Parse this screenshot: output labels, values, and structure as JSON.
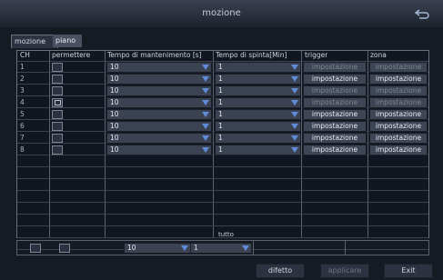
{
  "window": {
    "title": "mozione"
  },
  "tabs": [
    {
      "label": "mozione"
    },
    {
      "label": "piano"
    }
  ],
  "headers": {
    "ch": "CH",
    "permettere": "permettere",
    "tempo_mantenimento": "Tempo di mantenimento [s]",
    "tempo_spinta": "Tempo di spinta[Min]",
    "trigger": "trigger",
    "zona": "zona"
  },
  "rows": [
    {
      "ch": "1",
      "enabled": false,
      "hold": "10",
      "push": "1",
      "trigger": "impostazione",
      "zona": "impostazione",
      "trigger_enabled": false,
      "zona_enabled": false
    },
    {
      "ch": "2",
      "enabled": false,
      "hold": "10",
      "push": "1",
      "trigger": "impostazione",
      "zona": "impostazione",
      "trigger_enabled": true,
      "zona_enabled": true
    },
    {
      "ch": "3",
      "enabled": false,
      "hold": "10",
      "push": "1",
      "trigger": "impostazione",
      "zona": "impostazione",
      "trigger_enabled": false,
      "zona_enabled": false
    },
    {
      "ch": "4",
      "enabled": true,
      "hold": "10",
      "push": "1",
      "trigger": "impostazione",
      "zona": "impostazione",
      "trigger_enabled": false,
      "zona_enabled": false
    },
    {
      "ch": "5",
      "enabled": false,
      "hold": "10",
      "push": "1",
      "trigger": "impostazione",
      "zona": "impostazione",
      "trigger_enabled": true,
      "zona_enabled": true
    },
    {
      "ch": "6",
      "enabled": false,
      "hold": "10",
      "push": "1",
      "trigger": "impostazione",
      "zona": "impostazione",
      "trigger_enabled": true,
      "zona_enabled": true
    },
    {
      "ch": "7",
      "enabled": false,
      "hold": "10",
      "push": "1",
      "trigger": "impostazione",
      "zona": "impostazione",
      "trigger_enabled": true,
      "zona_enabled": true
    },
    {
      "ch": "8",
      "enabled": false,
      "hold": "10",
      "push": "1",
      "trigger": "impostazione",
      "zona": "impostazione",
      "trigger_enabled": true,
      "zona_enabled": true
    }
  ],
  "tutto": {
    "label": "tutto",
    "hold": "10",
    "push": "1"
  },
  "footer": {
    "default": "difetto",
    "apply": "applicare",
    "exit": "Exit"
  }
}
